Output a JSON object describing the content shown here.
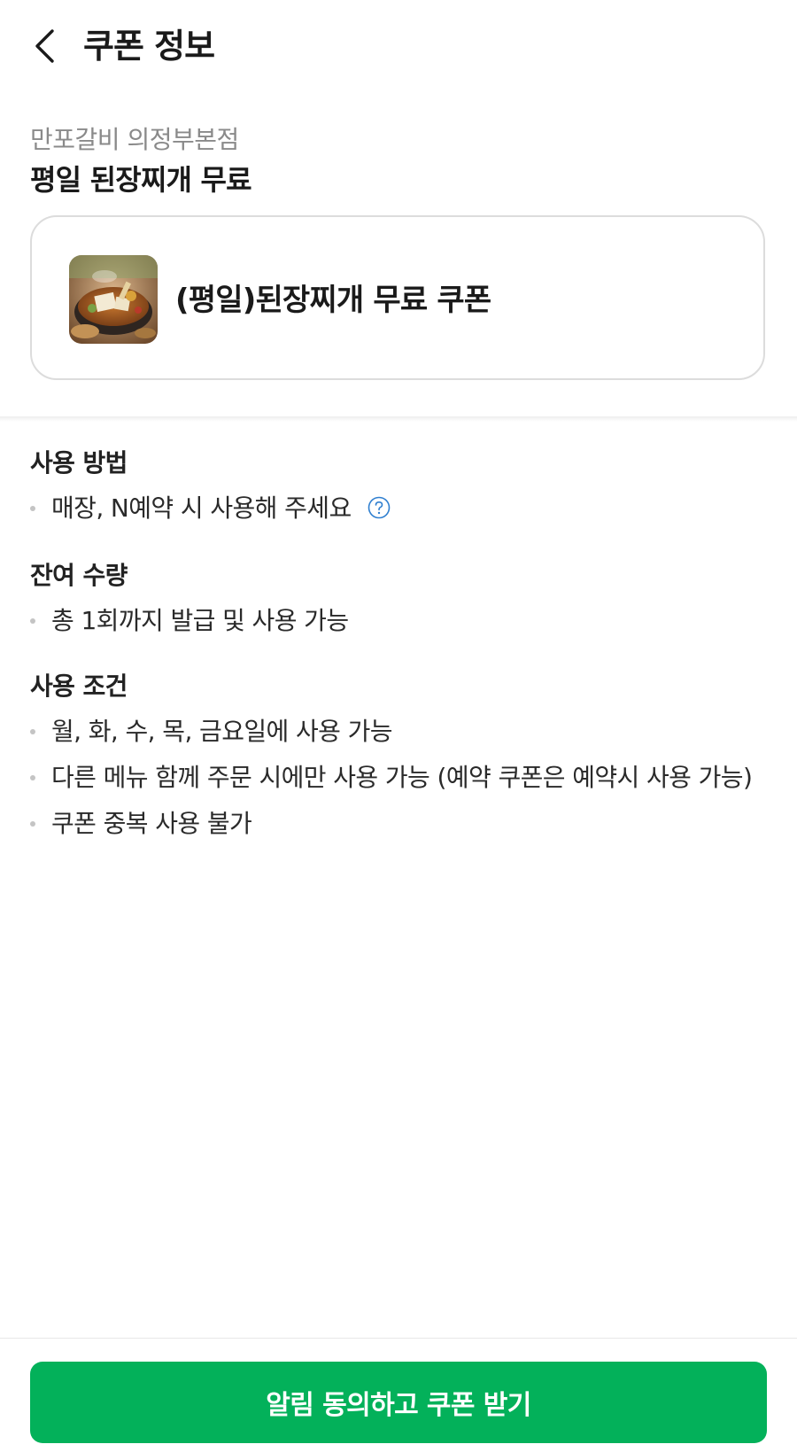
{
  "header": {
    "back_icon": "chevron-left-icon",
    "title": "쿠폰 정보"
  },
  "store": {
    "name": "만포갈비 의정부본점"
  },
  "coupon": {
    "title": "평일 된장찌개 무료",
    "card_name": "(평일)된장찌개 무료 쿠폰",
    "thumbnail_icon": "doenjang-jjigae-food-photo"
  },
  "sections": {
    "usage_method": {
      "title": "사용 방법",
      "items": [
        "매장, N예약 시 사용해 주세요"
      ],
      "help_icon": "question-circle-icon"
    },
    "remaining": {
      "title": "잔여 수량",
      "items": [
        "총 1회까지 발급 및 사용 가능"
      ]
    },
    "conditions": {
      "title": "사용 조건",
      "items": [
        "월, 화, 수, 목, 금요일에 사용 가능",
        "다른 메뉴 함께 주문 시에만 사용 가능 (예약 쿠폰은 예약시 사용 가능)",
        "쿠폰 중복 사용 불가"
      ]
    }
  },
  "footer": {
    "cta_label": "알림 동의하고 쿠폰 받기"
  },
  "colors": {
    "accent": "#03b15a",
    "help_icon": "#2f7fd0",
    "muted_text": "#8a8a8a",
    "card_border": "#dcdcdc"
  }
}
